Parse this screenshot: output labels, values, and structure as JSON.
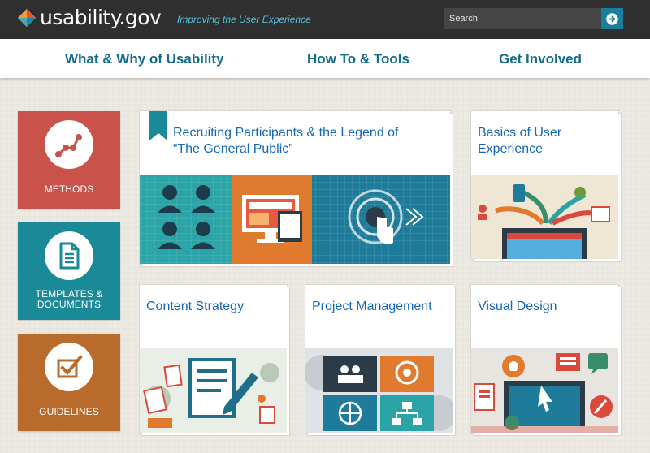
{
  "header": {
    "logo_text": "usability.gov",
    "tagline": "Improving the User Experience",
    "search": {
      "placeholder": "Search"
    }
  },
  "nav": {
    "items": [
      {
        "label": "What & Why of Usability"
      },
      {
        "label": "How To & Tools"
      },
      {
        "label": "Get Involved"
      }
    ]
  },
  "categories": [
    {
      "label": "METHODS",
      "color": "#c9524b",
      "icon": "methods-chart-icon"
    },
    {
      "label": "TEMPLATES & DOCUMENTS",
      "color": "#1a8a98",
      "icon": "document-icon"
    },
    {
      "label": "GUIDELINES",
      "color": "#b86b2a",
      "icon": "checkbox-icon"
    }
  ],
  "cards": [
    {
      "title": "Recruiting Participants & the Legend of “The General Public”",
      "featured": true
    },
    {
      "title": "Basics of User Experience"
    },
    {
      "title": "Content Strategy"
    },
    {
      "title": "Project Management"
    },
    {
      "title": "Visual Design"
    }
  ],
  "colors": {
    "header_bg": "#2f2f2f",
    "accent_teal": "#1a7f9c",
    "nav_text": "#166d89",
    "card_title": "#1568b5"
  }
}
